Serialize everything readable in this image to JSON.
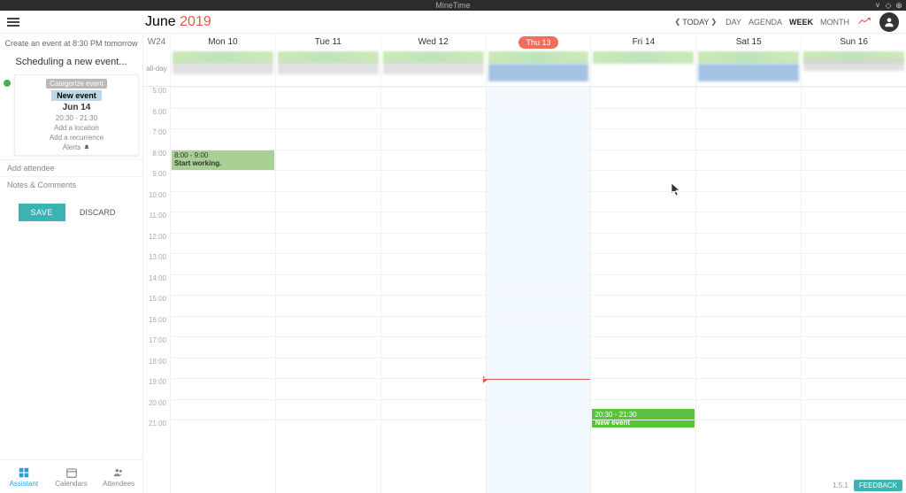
{
  "app_title": "MineTime",
  "header": {
    "month": "June",
    "year": "2019",
    "today_label": "TODAY",
    "views": [
      "DAY",
      "AGENDA",
      "WEEK",
      "MONTH"
    ],
    "active_view": "WEEK"
  },
  "sidebar": {
    "quick_hint": "Create an event at 8:30 PM tomorrow",
    "scheduling_label": "Scheduling a new event...",
    "card": {
      "categorize": "Categorize event",
      "title": "New event",
      "date": "Jun 14",
      "time": "20:30 - 21:30",
      "add_location": "Add a location",
      "add_recurrence": "Add a recurrence",
      "alerts": "Alerts"
    },
    "add_attendee": "Add attendee",
    "notes": "Notes & Comments",
    "save": "SAVE",
    "discard": "DISCARD",
    "bottom": {
      "assistant": "Assistant",
      "calendars": "Calendars",
      "attendees": "Attendees"
    }
  },
  "calendar": {
    "week_label": "W24",
    "days": [
      {
        "label": "Mon 10",
        "today": false
      },
      {
        "label": "Tue 11",
        "today": false
      },
      {
        "label": "Wed 12",
        "today": false
      },
      {
        "label": "Thu 13",
        "today": true
      },
      {
        "label": "Fri 14",
        "today": false
      },
      {
        "label": "Sat 15",
        "today": false
      },
      {
        "label": "Sun 16",
        "today": false
      }
    ],
    "allday_label": "all-day",
    "hours": [
      "5:00",
      "6:00",
      "7:00",
      "8:00",
      "9:00",
      "10:00",
      "11:00",
      "12:00",
      "13:00",
      "14:00",
      "15:00",
      "16:00",
      "17:00",
      "18:00",
      "19:00",
      "20:00",
      "21:00"
    ],
    "events": {
      "mon_work": {
        "time": "8:00 - 9:00",
        "title": "Start working."
      },
      "fri_new": {
        "time": "20:30 - 21:30",
        "title": "New event"
      }
    }
  },
  "footer": {
    "version": "1.5.1",
    "feedback": "FEEDBACK"
  }
}
